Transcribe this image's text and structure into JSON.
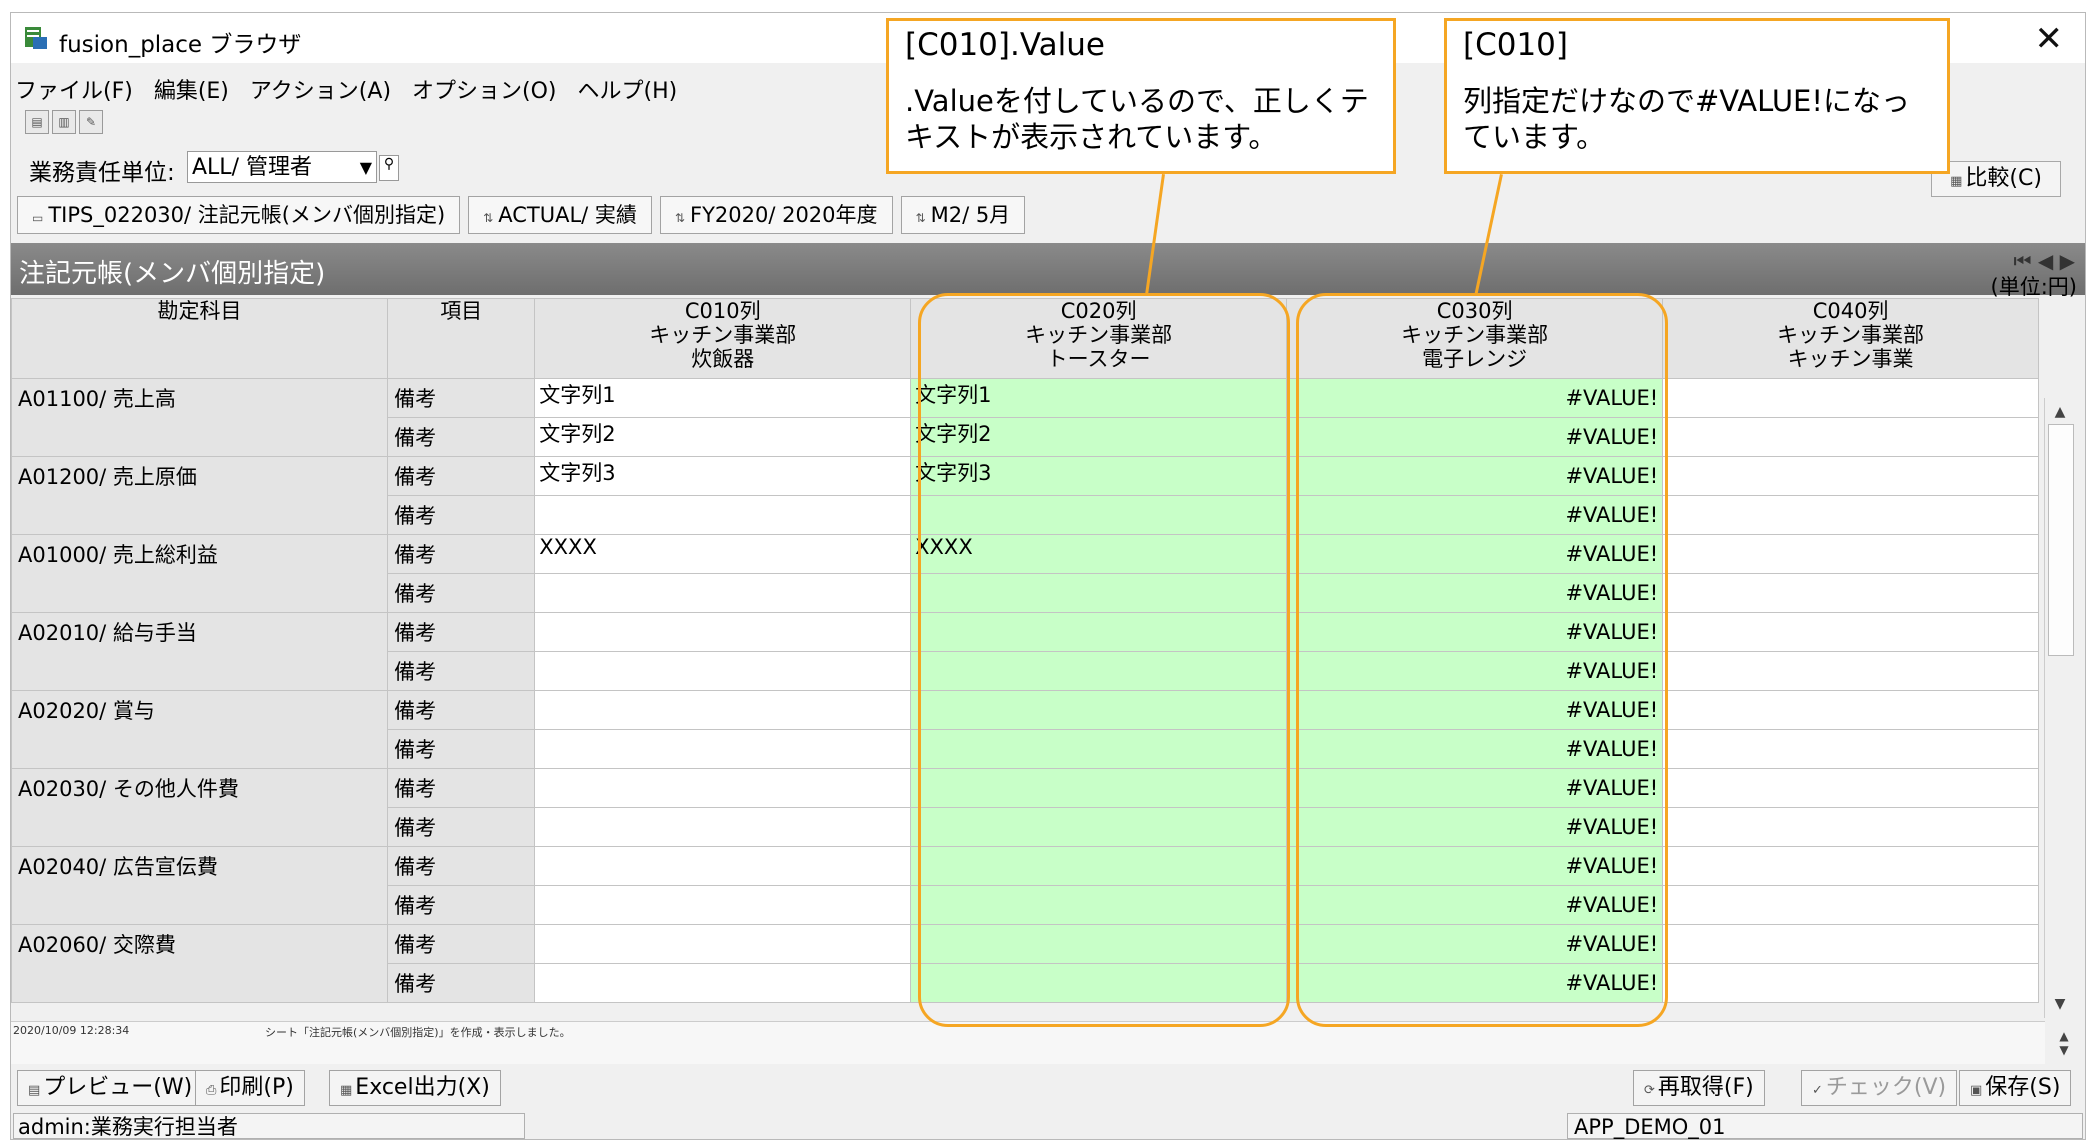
{
  "window": {
    "title": "fusion_place ブラウザ"
  },
  "menu": [
    "ファイル(F)",
    "編集(E)",
    "アクション(A)",
    "オプション(O)",
    "ヘルプ(H)"
  ],
  "responsibility": {
    "label": "業務責任単位:",
    "value": "ALL/ 管理者"
  },
  "compare_label": "比較(C)",
  "tabs": [
    {
      "label": "TIPS_022030/ 注記元帳(メンバ個別指定)"
    },
    {
      "label": "ACTUAL/ 実績"
    },
    {
      "label": "FY2020/ 2020年度"
    },
    {
      "label": "M2/ 5月"
    }
  ],
  "sheet": {
    "title": "注記元帳(メンバ個別指定)",
    "unit": "(単位:円)"
  },
  "grid": {
    "col_account": "勘定科目",
    "col_item": "項目",
    "columns": [
      {
        "line1": "C010列",
        "line2": "キッチン事業部",
        "line3": "炊飯器"
      },
      {
        "line1": "C020列",
        "line2": "キッチン事業部",
        "line3": "トースター"
      },
      {
        "line1": "C030列",
        "line2": "キッチン事業部",
        "line3": "電子レンジ"
      },
      {
        "line1": "C040列",
        "line2": "キッチン事業部",
        "line3": "キッチン事業"
      }
    ],
    "groups": [
      {
        "account": "A01100/ 売上高",
        "rows": [
          {
            "item": "備考",
            "c010": "文字列1",
            "c020": "文字列1",
            "c030": "#VALUE!"
          },
          {
            "item": "備考",
            "c010": "文字列2",
            "c020": "文字列2",
            "c030": "#VALUE!"
          }
        ]
      },
      {
        "account": "A01200/ 売上原価",
        "rows": [
          {
            "item": "備考",
            "c010": "文字列3",
            "c020": "文字列3",
            "c030": "#VALUE!"
          },
          {
            "item": "備考",
            "c010": "",
            "c020": "",
            "c030": "#VALUE!"
          }
        ]
      },
      {
        "account": "A01000/ 売上総利益",
        "rows": [
          {
            "item": "備考",
            "c010": "XXXX",
            "c020": "XXXX",
            "c030": "#VALUE!"
          },
          {
            "item": "備考",
            "c010": "",
            "c020": "",
            "c030": "#VALUE!"
          }
        ]
      },
      {
        "account": "A02010/ 給与手当",
        "rows": [
          {
            "item": "備考",
            "c010": "",
            "c020": "",
            "c030": "#VALUE!"
          },
          {
            "item": "備考",
            "c010": "",
            "c020": "",
            "c030": "#VALUE!"
          }
        ]
      },
      {
        "account": "A02020/ 賞与",
        "rows": [
          {
            "item": "備考",
            "c010": "",
            "c020": "",
            "c030": "#VALUE!"
          },
          {
            "item": "備考",
            "c010": "",
            "c020": "",
            "c030": "#VALUE!"
          }
        ]
      },
      {
        "account": "A02030/ その他人件費",
        "rows": [
          {
            "item": "備考",
            "c010": "",
            "c020": "",
            "c030": "#VALUE!"
          },
          {
            "item": "備考",
            "c010": "",
            "c020": "",
            "c030": "#VALUE!"
          }
        ]
      },
      {
        "account": "A02040/ 広告宣伝費",
        "rows": [
          {
            "item": "備考",
            "c010": "",
            "c020": "",
            "c030": "#VALUE!"
          },
          {
            "item": "備考",
            "c010": "",
            "c020": "",
            "c030": "#VALUE!"
          }
        ]
      },
      {
        "account": "A02060/ 交際費",
        "rows": [
          {
            "item": "備考",
            "c010": "",
            "c020": "",
            "c030": "#VALUE!"
          },
          {
            "item": "備考",
            "c010": "",
            "c020": "",
            "c030": "#VALUE!"
          }
        ]
      }
    ]
  },
  "log": {
    "timestamp": "2020/10/09 12:28:34",
    "message": "シート「注記元帳(メンバ個別指定)」を作成・表示しました。"
  },
  "buttons": {
    "preview": "プレビュー(W)",
    "print": "印刷(P)",
    "excel": "Excel出力(X)",
    "refetch": "再取得(F)",
    "check": "チェック(V)",
    "save": "保存(S)"
  },
  "status": {
    "left": "admin:業務実行担当者",
    "right": "APP_DEMO_01"
  },
  "callouts": [
    {
      "head": "[C010].Value",
      "body": ".Valueを付しているので、正しくテキストが表示されています。"
    },
    {
      "head": "[C010]",
      "body": "列指定だけなので#VALUE!になっています。"
    }
  ],
  "colors": {
    "highlight": "#f5a623",
    "green_cell": "#c8ffc8",
    "header_bar": "#7a7a7a"
  },
  "icons": [
    "app-icon",
    "close-icon",
    "search-icon",
    "compare-icon",
    "nav-first-icon",
    "nav-prev-icon",
    "nav-next-icon",
    "scroll-up-icon",
    "scroll-down-icon"
  ]
}
